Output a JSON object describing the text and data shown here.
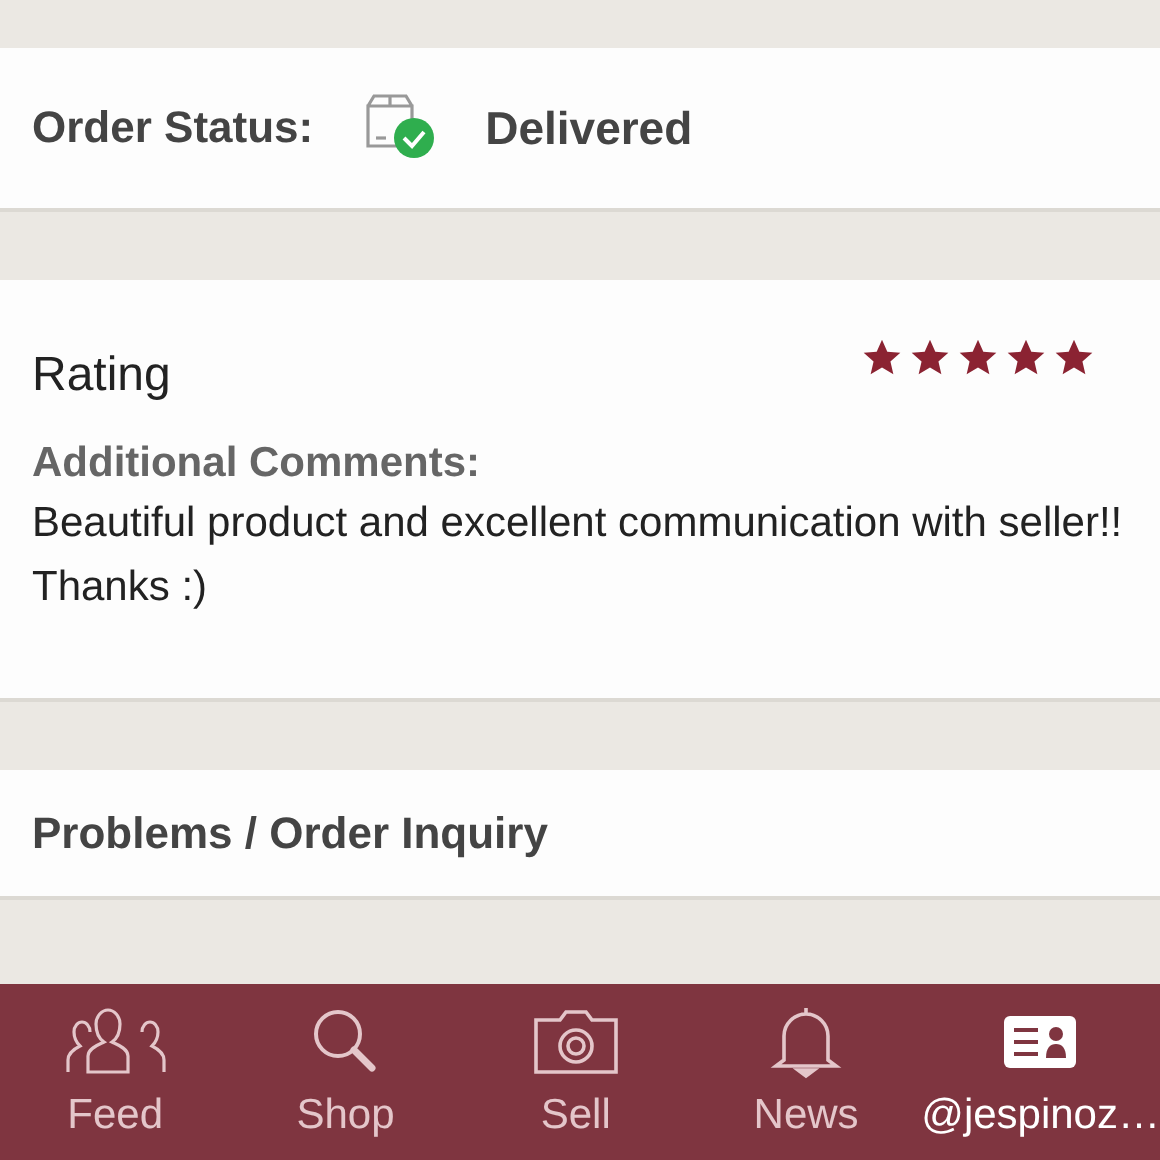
{
  "order_status": {
    "label": "Order Status:",
    "value": "Delivered"
  },
  "rating": {
    "title": "Rating",
    "stars": 5,
    "comments_label": "Additional Comments:",
    "comments": "Beautiful product and excellent communication with seller!! Thanks :)"
  },
  "problems": {
    "title": "Problems / Order Inquiry"
  },
  "nav": [
    {
      "kind": "feed",
      "label": "Feed",
      "selected": false
    },
    {
      "kind": "shop",
      "label": "Shop",
      "selected": false
    },
    {
      "kind": "sell",
      "label": "Sell",
      "selected": false
    },
    {
      "kind": "news",
      "label": "News",
      "selected": false
    },
    {
      "kind": "profile",
      "label": "@jespinoz…",
      "selected": true
    }
  ]
}
